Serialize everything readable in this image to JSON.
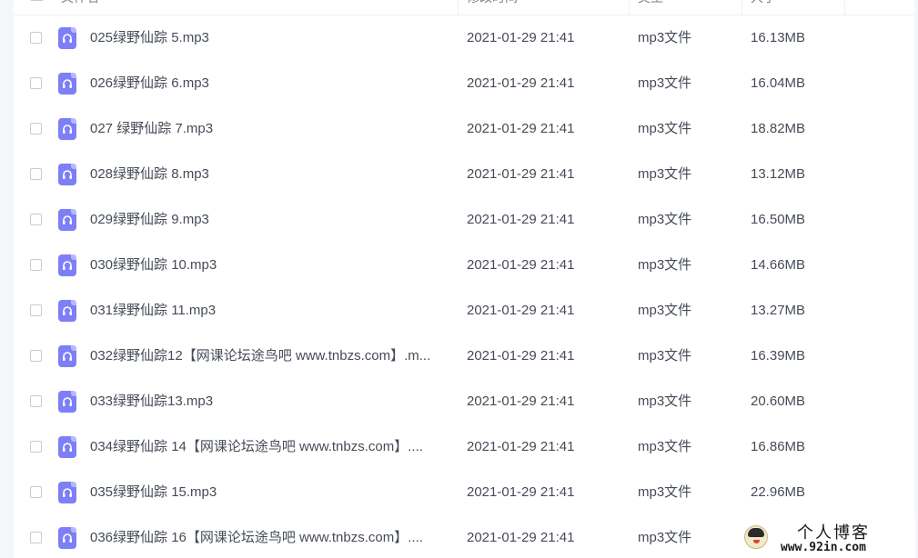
{
  "header": {
    "name_label": "文件名",
    "time_label": "修改时间",
    "type_label": "类型",
    "size_label": "大小"
  },
  "rows": [
    {
      "name": "025绿野仙踪 5.mp3",
      "time": "2021-01-29 21:41",
      "type": "mp3文件",
      "size": "16.13MB"
    },
    {
      "name": "026绿野仙踪 6.mp3",
      "time": "2021-01-29 21:41",
      "type": "mp3文件",
      "size": "16.04MB"
    },
    {
      "name": "027 绿野仙踪 7.mp3",
      "time": "2021-01-29 21:41",
      "type": "mp3文件",
      "size": "18.82MB"
    },
    {
      "name": "028绿野仙踪 8.mp3",
      "time": "2021-01-29 21:41",
      "type": "mp3文件",
      "size": "13.12MB"
    },
    {
      "name": "029绿野仙踪 9.mp3",
      "time": "2021-01-29 21:41",
      "type": "mp3文件",
      "size": "16.50MB"
    },
    {
      "name": "030绿野仙踪 10.mp3",
      "time": "2021-01-29 21:41",
      "type": "mp3文件",
      "size": "14.66MB"
    },
    {
      "name": "031绿野仙踪 11.mp3",
      "time": "2021-01-29 21:41",
      "type": "mp3文件",
      "size": "13.27MB"
    },
    {
      "name": "032绿野仙踪12【网课论坛途鸟吧 www.tnbzs.com】.m...",
      "time": "2021-01-29 21:41",
      "type": "mp3文件",
      "size": "16.39MB"
    },
    {
      "name": "033绿野仙踪13.mp3",
      "time": "2021-01-29 21:41",
      "type": "mp3文件",
      "size": "20.60MB"
    },
    {
      "name": "034绿野仙踪 14【网课论坛途鸟吧 www.tnbzs.com】....",
      "time": "2021-01-29 21:41",
      "type": "mp3文件",
      "size": "16.86MB"
    },
    {
      "name": "035绿野仙踪 15.mp3",
      "time": "2021-01-29 21:41",
      "type": "mp3文件",
      "size": "22.96MB"
    },
    {
      "name": "036绿野仙踪 16【网课论坛途鸟吧 www.tnbzs.com】....",
      "time": "2021-01-29 21:41",
      "type": "mp3文件",
      "size": ""
    }
  ],
  "icons": {
    "file": "audio-file-icon",
    "sort": "sort-desc-icon"
  },
  "colors": {
    "file_icon": "#7d7ff7",
    "sort_accent": "#5b7cf0",
    "text": "#454b57"
  },
  "watermark": {
    "title": "个人博客",
    "url": "www.92in.com"
  }
}
